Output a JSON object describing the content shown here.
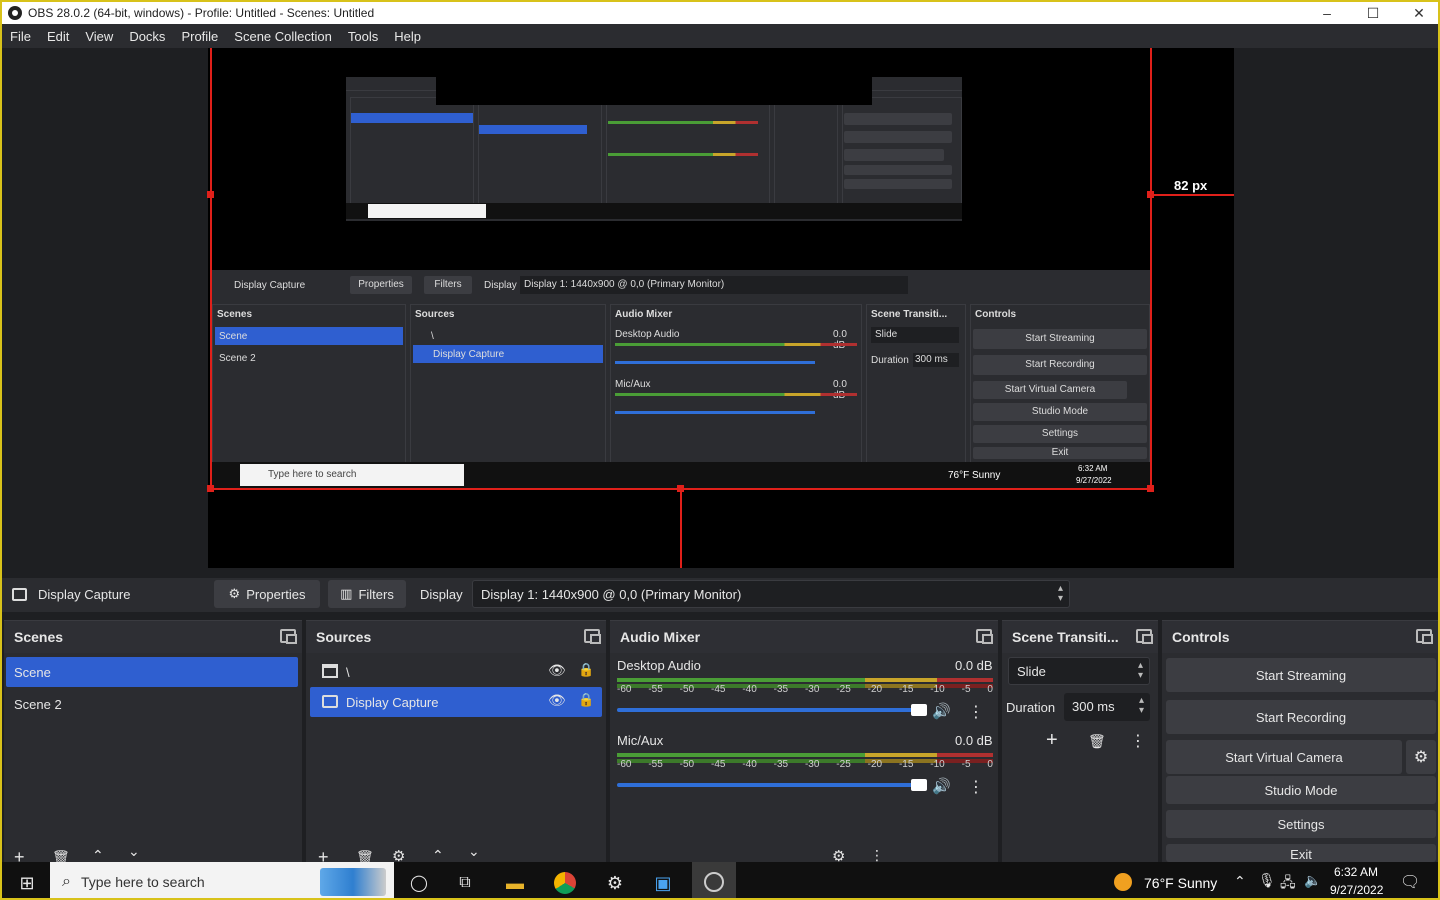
{
  "window": {
    "title": "OBS 28.0.2 (64-bit, windows) - Profile: Untitled - Scenes: Untitled",
    "minimize": "–",
    "maximize": "☐",
    "close": "✕"
  },
  "menu": [
    "File",
    "Edit",
    "View",
    "Docks",
    "Profile",
    "Scene Collection",
    "Tools",
    "Help"
  ],
  "preview": {
    "distance_label": "82 px"
  },
  "nested_large": {
    "source_name": "Display Capture",
    "properties": "Properties",
    "filters": "Filters",
    "display_label": "Display",
    "display_value": "Display 1: 1440x900 @ 0,0 (Primary Monitor)",
    "scenes_title": "Scenes",
    "sources_title": "Sources",
    "mixer_title": "Audio Mixer",
    "transitions_title": "Scene Transiti...",
    "controls_title": "Controls",
    "scene1": "Scene",
    "scene2": "Scene 2",
    "src1": "\\",
    "src2": "Display Capture",
    "desktop_audio": "Desktop Audio",
    "mic_aux": "Mic/Aux",
    "db": "0.0 dB",
    "slide": "Slide",
    "duration": "Duration",
    "duration_val": "300 ms",
    "start_streaming": "Start Streaming",
    "start_recording": "Start Recording",
    "start_virtual_camera": "Start Virtual Camera",
    "studio_mode": "Studio Mode",
    "settings": "Settings",
    "exit": "Exit",
    "search": "Type here to search",
    "weather": "76°F  Sunny",
    "time": "6:32 AM",
    "date": "9/27/2022"
  },
  "source_toolbar": {
    "source_name": "Display Capture",
    "properties": "Properties",
    "filters": "Filters",
    "display_label": "Display",
    "display_value": "Display 1: 1440x900 @ 0,0 (Primary Monitor)"
  },
  "scenes": {
    "title": "Scenes",
    "items": [
      "Scene",
      "Scene 2"
    ]
  },
  "sources": {
    "title": "Sources",
    "items": [
      "\\",
      "Display Capture"
    ]
  },
  "mixer": {
    "title": "Audio Mixer",
    "ticks": [
      "-60",
      "-55",
      "-50",
      "-45",
      "-40",
      "-35",
      "-30",
      "-25",
      "-20",
      "-15",
      "-10",
      "-5",
      "0"
    ],
    "channels": [
      {
        "name": "Desktop Audio",
        "level": "0.0 dB"
      },
      {
        "name": "Mic/Aux",
        "level": "0.0 dB"
      }
    ]
  },
  "transitions": {
    "title": "Scene Transiti...",
    "type": "Slide",
    "duration_label": "Duration",
    "duration_value": "300 ms"
  },
  "controls": {
    "title": "Controls",
    "start_streaming": "Start Streaming",
    "start_recording": "Start Recording",
    "start_virtual_camera": "Start Virtual Camera",
    "studio_mode": "Studio Mode",
    "settings": "Settings",
    "exit": "Exit"
  },
  "taskbar": {
    "search_placeholder": "Type here to search",
    "weather": "76°F  Sunny",
    "time": "6:32 AM",
    "date": "9/27/2022"
  },
  "colors": {
    "accent": "#2f5fd0",
    "selection_red": "#e0201a",
    "panel": "#2b2c30",
    "window_border": "#d8c21a"
  }
}
